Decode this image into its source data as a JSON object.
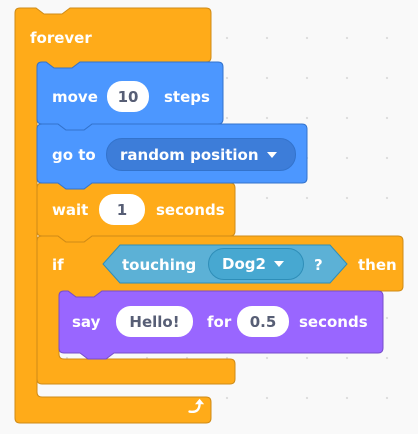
{
  "colors": {
    "control": "#ffab19",
    "control_edge": "#cf8b17",
    "motion": "#4c97ff",
    "motion_edge": "#3373cc",
    "looks": "#9966ff",
    "looks_edge": "#774dcb",
    "sensing": "#5cb1d6",
    "sensing_edge": "#2e8eb8",
    "menu_fill": "#3d7dd9",
    "sensing_menu": "#47a8d1"
  },
  "blocks": {
    "forever": {
      "label": "forever",
      "loop_icon": "loop-arrow-icon"
    },
    "move": {
      "verb": "move",
      "steps": "10",
      "unit": "steps"
    },
    "goto": {
      "verb": "go to",
      "target": "random position"
    },
    "wait": {
      "verb": "wait",
      "seconds": "1",
      "unit": "seconds"
    },
    "if": {
      "keyword": "if",
      "then": "then",
      "condition": {
        "label": "touching",
        "object": "Dog2",
        "question": "?"
      }
    },
    "say": {
      "verb": "say",
      "message": "Hello!",
      "for": "for",
      "seconds": "0.5",
      "unit": "seconds"
    }
  }
}
